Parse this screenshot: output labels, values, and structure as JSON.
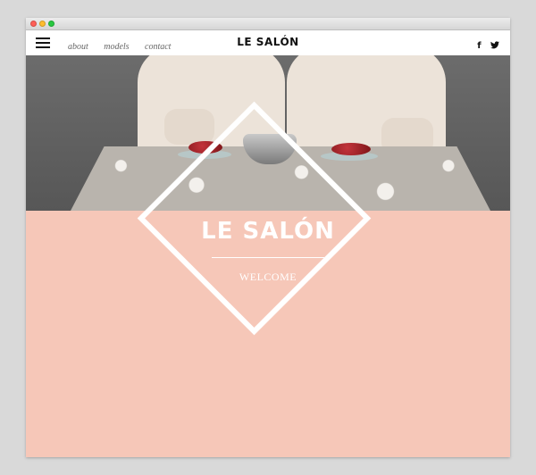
{
  "window": {
    "background": "#d9d9d9",
    "traffic_lights": {
      "close": "#ff5f57",
      "minimize": "#ffbd2e",
      "maximize": "#28c840"
    }
  },
  "navbar": {
    "menu_icon": "hamburger-menu-icon",
    "links": [
      {
        "label": "about"
      },
      {
        "label": "models"
      },
      {
        "label": "contact"
      }
    ],
    "brand": "LE SALÓN",
    "social": [
      {
        "icon": "facebook-icon",
        "glyph": "f"
      },
      {
        "icon": "twitter-icon",
        "glyph": "🐦"
      }
    ]
  },
  "hero": {
    "background_image": "photo of two women seated at a patterned table with plates of red fruit and a glass bowl"
  },
  "welcome": {
    "title": "LE SALÓN",
    "subtitle": "WELCOME",
    "accent_color": "#f6c7b8",
    "frame_color": "#ffffff"
  }
}
